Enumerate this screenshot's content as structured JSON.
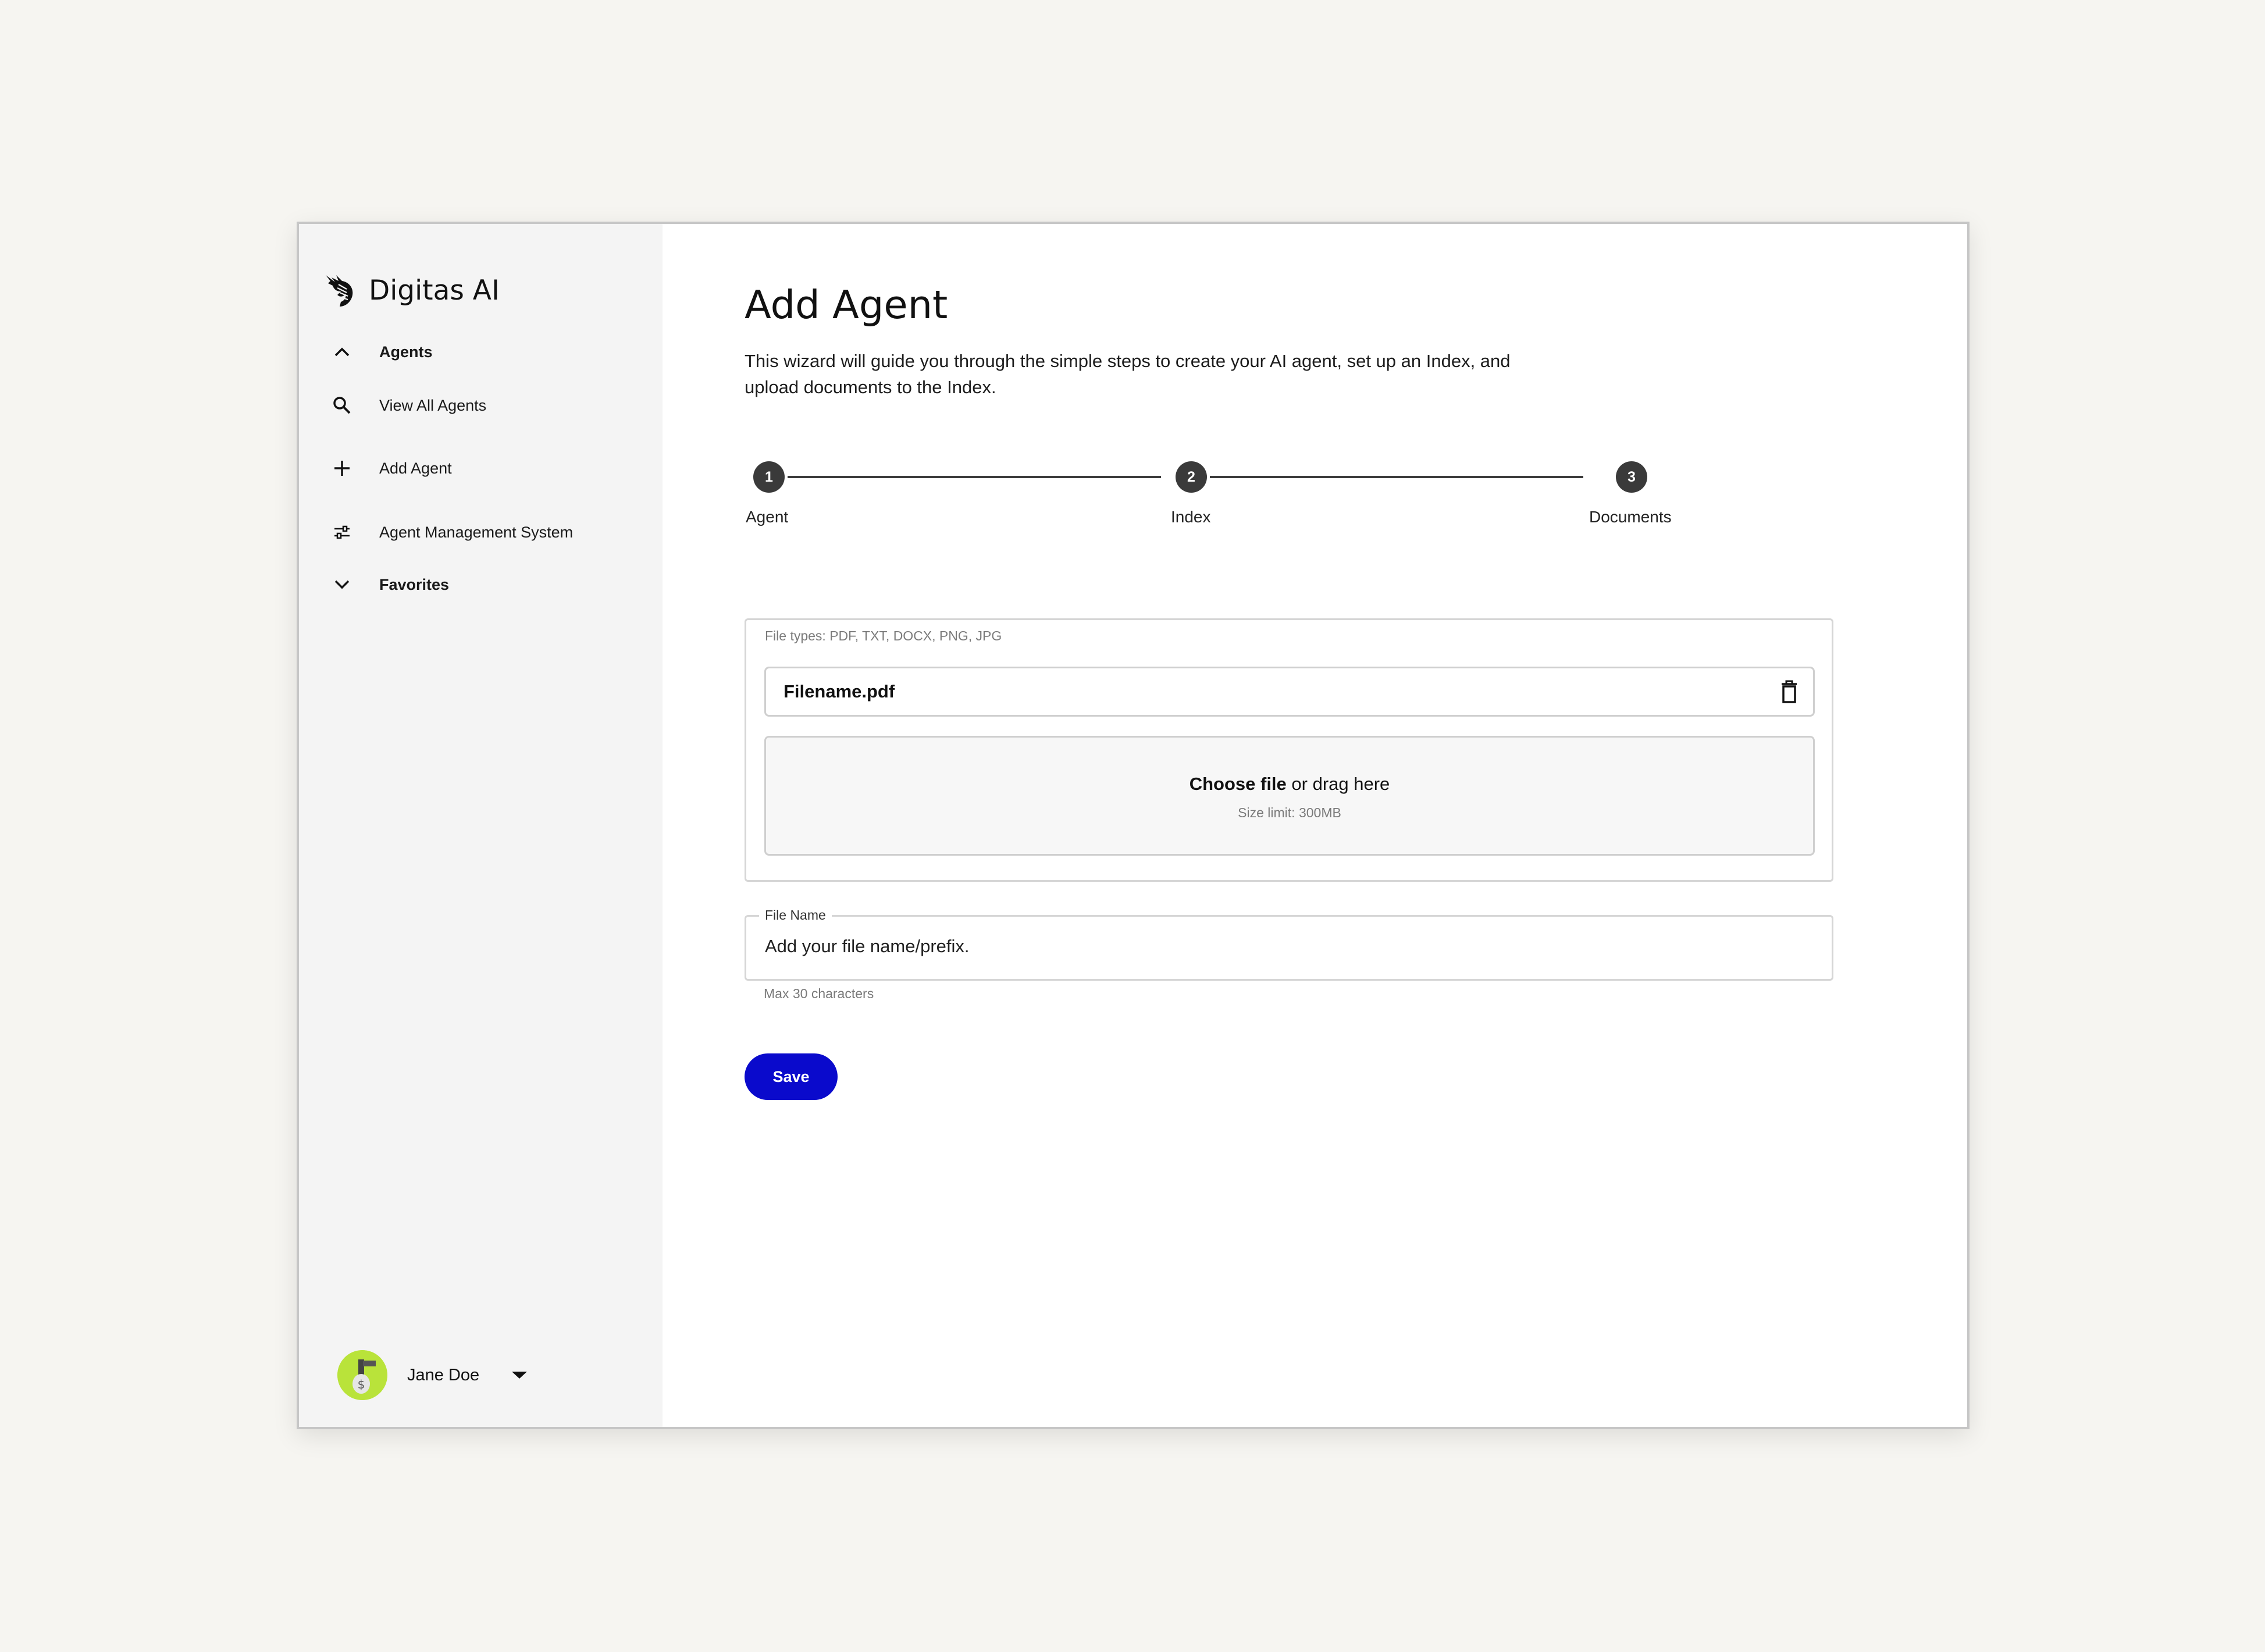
{
  "app": {
    "brand_name": "Digitas AI"
  },
  "sidebar": {
    "items": [
      {
        "label": "Agents",
        "icon": "chevron-up-icon"
      },
      {
        "label": "View All Agents",
        "icon": "search-icon"
      },
      {
        "label": "Add Agent",
        "icon": "plus-icon"
      },
      {
        "label": "Agent Management System",
        "icon": "sliders-icon"
      },
      {
        "label": "Favorites",
        "icon": "chevron-down-icon"
      }
    ],
    "user": {
      "name": "Jane Doe"
    }
  },
  "main": {
    "title": "Add Agent",
    "description": "This wizard will guide you through the simple steps to create your AI agent, set up an Index, and upload documents to the Index.",
    "steps": [
      {
        "number": "1",
        "label": "Agent"
      },
      {
        "number": "2",
        "label": "Index"
      },
      {
        "number": "3",
        "label": "Documents"
      }
    ],
    "upload": {
      "file_types": "File types: PDF, TXT, DOCX, PNG, JPG",
      "uploaded_file": "Filename.pdf",
      "choose_file": "Choose file",
      "drag_text": " or drag here",
      "size_limit": "Size limit: 300MB"
    },
    "file_name_field": {
      "label": "File Name",
      "placeholder": "Add your file name/prefix.",
      "helper": "Max 30 characters"
    },
    "save_label": "Save"
  },
  "colors": {
    "accent": "#0a0acc",
    "sidebar_bg": "#f4f4f4",
    "page_bg": "#f6f5f1",
    "step_dark": "#3a3a3a",
    "avatar_bg": "#b9e33a"
  }
}
